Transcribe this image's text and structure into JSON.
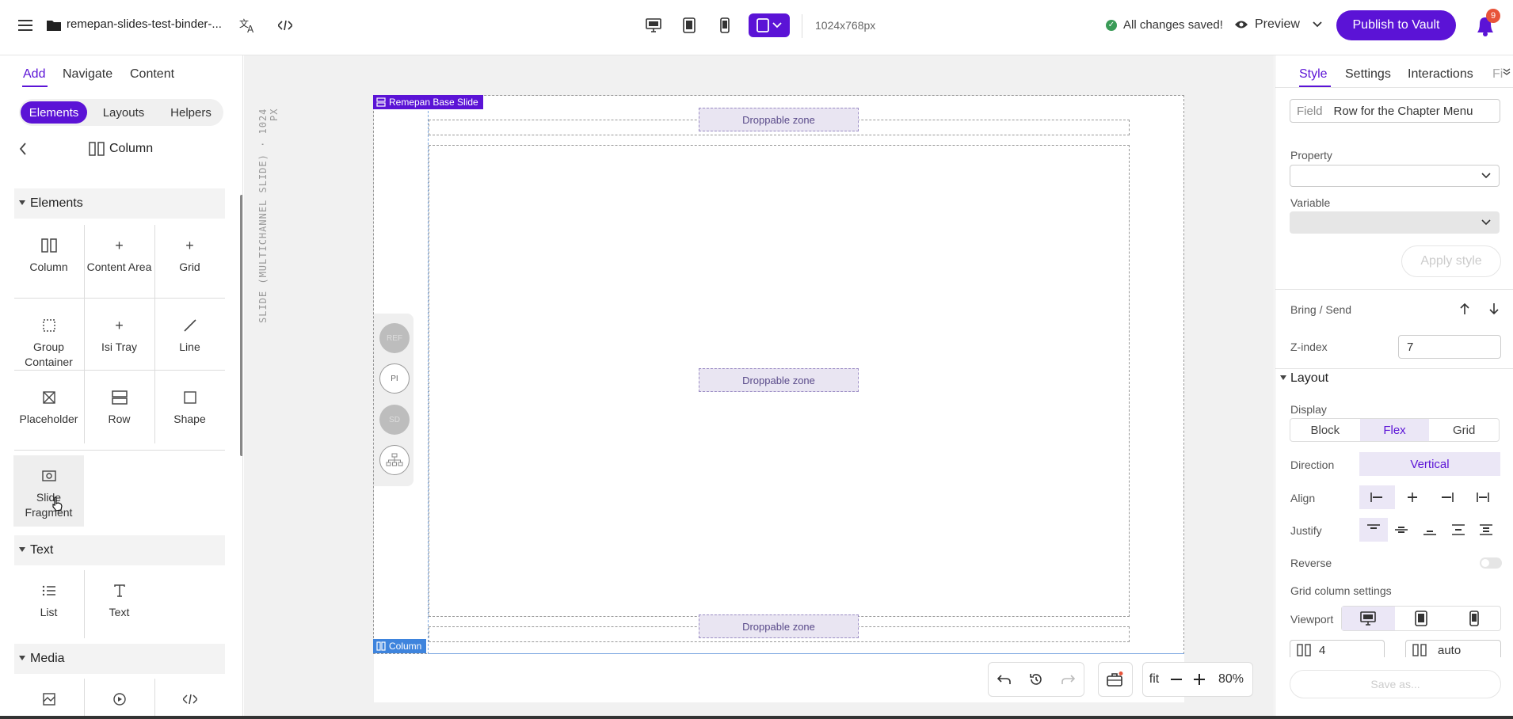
{
  "topbar": {
    "doc_title": "remepan-slides-test-binder-...",
    "size_label": "1024x768px",
    "saved_status": "All changes saved!",
    "preview_label": "Preview",
    "publish_label": "Publish to Vault",
    "notification_count": "9",
    "accent_color": "#5b13d6"
  },
  "left_panel": {
    "tabs": [
      "Add",
      "Navigate",
      "Content"
    ],
    "subtabs": [
      "Elements",
      "Layouts",
      "Helpers"
    ],
    "header_title": "Column",
    "sections": {
      "elements": {
        "title": "Elements",
        "items": [
          "Column",
          "Content Area",
          "Grid",
          "Group Container",
          "Isi Tray",
          "Line",
          "Placeholder",
          "Row",
          "Shape",
          "Slide Fragment"
        ]
      },
      "text": {
        "title": "Text",
        "items": [
          "List",
          "Text"
        ]
      },
      "media": {
        "title": "Media"
      }
    }
  },
  "canvas": {
    "vertical_label": "SLIDE (MULTICHANNEL SLIDE) · 1024 PX",
    "slide_label": "Remepan Base Slide",
    "column_label": "Column",
    "drop_zone_label": "Droppable zone",
    "side_tools": [
      "REF",
      "PI",
      "SD"
    ],
    "zoom_fit": "fit",
    "zoom_level": "80%"
  },
  "right_panel": {
    "tabs": [
      "Style",
      "Settings",
      "Interactions",
      "Fi"
    ],
    "field_label": "Field",
    "field_value": "Row for the Chapter Menu",
    "property_label": "Property",
    "variable_label": "Variable",
    "apply_style": "Apply style",
    "bring_send_label": "Bring / Send",
    "zindex_label": "Z-index",
    "zindex_value": "7",
    "layout_title": "Layout",
    "display_label": "Display",
    "display_options": [
      "Block",
      "Flex",
      "Grid"
    ],
    "direction_label": "Direction",
    "direction_value": "Vertical",
    "align_label": "Align",
    "justify_label": "Justify",
    "reverse_label": "Reverse",
    "grid_col_settings": "Grid column settings",
    "viewport_label": "Viewport",
    "grid_cols_value": "4",
    "grid_auto_value": "auto",
    "save_as": "Save as..."
  }
}
